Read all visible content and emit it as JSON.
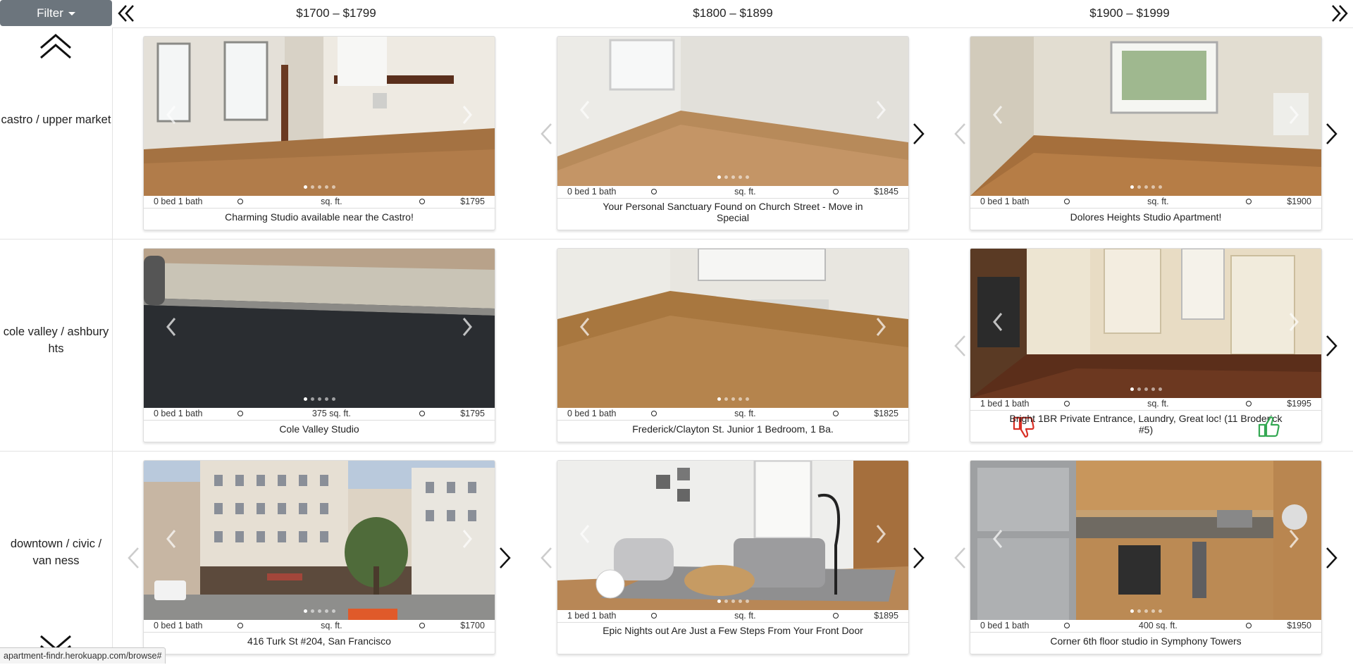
{
  "filter_label": "Filter",
  "price_columns": [
    "$1700 – $1799",
    "$1800 – $1899",
    "$1900 – $1999"
  ],
  "rows": [
    {
      "label": "castro / upper market",
      "cards": [
        {
          "beds": "0 bed 1 bath",
          "sqft": "sq. ft.",
          "price": "$1795",
          "title": "Charming Studio available near the Castro!"
        },
        {
          "beds": "0 bed 1 bath",
          "sqft": "sq. ft.",
          "price": "$1845",
          "title": "Your Personal Sanctuary Found on Church Street - Move in Special"
        },
        {
          "beds": "0 bed 1 bath",
          "sqft": "sq. ft.",
          "price": "$1900",
          "title": "Dolores Heights Studio Apartment!"
        }
      ]
    },
    {
      "label": "cole valley / ashbury hts",
      "cards": [
        {
          "beds": "0 bed 1 bath",
          "sqft": "375 sq. ft.",
          "price": "$1795",
          "title": "Cole Valley Studio"
        },
        {
          "beds": "0 bed 1 bath",
          "sqft": "sq. ft.",
          "price": "$1825",
          "title": "Frederick/Clayton St. Junior 1 Bedroom, 1 Ba."
        },
        {
          "beds": "1 bed 1 bath",
          "sqft": "sq. ft.",
          "price": "$1995",
          "title": "Bright 1BR Private Entrance, Laundry, Great loc! (11 Broderick #5)"
        }
      ]
    },
    {
      "label": "downtown / civic / van ness",
      "cards": [
        {
          "beds": "0 bed 1 bath",
          "sqft": "sq. ft.",
          "price": "$1700",
          "title": "416 Turk St #204, San Francisco"
        },
        {
          "beds": "1 bed 1 bath",
          "sqft": "sq. ft.",
          "price": "$1895",
          "title": "Epic Nights out Are Just a Few Steps From Your Front Door"
        },
        {
          "beds": "0 bed 1 bath",
          "sqft": "400 sq. ft.",
          "price": "$1950",
          "title": "Corner 6th floor studio in Symphony Towers"
        }
      ]
    }
  ],
  "status_url": "apartment-findr.herokuapp.com/browse#",
  "colors": {
    "filter_bg": "#6c757d",
    "thumbs_down": "#d93025",
    "thumbs_up": "#34a853"
  },
  "icons": [
    "chevron-double-left-icon",
    "chevron-double-right-icon",
    "chevron-double-up-icon",
    "chevron-double-down-icon",
    "chevron-left-icon",
    "chevron-right-icon",
    "thumbs-down-icon",
    "thumbs-up-icon"
  ]
}
